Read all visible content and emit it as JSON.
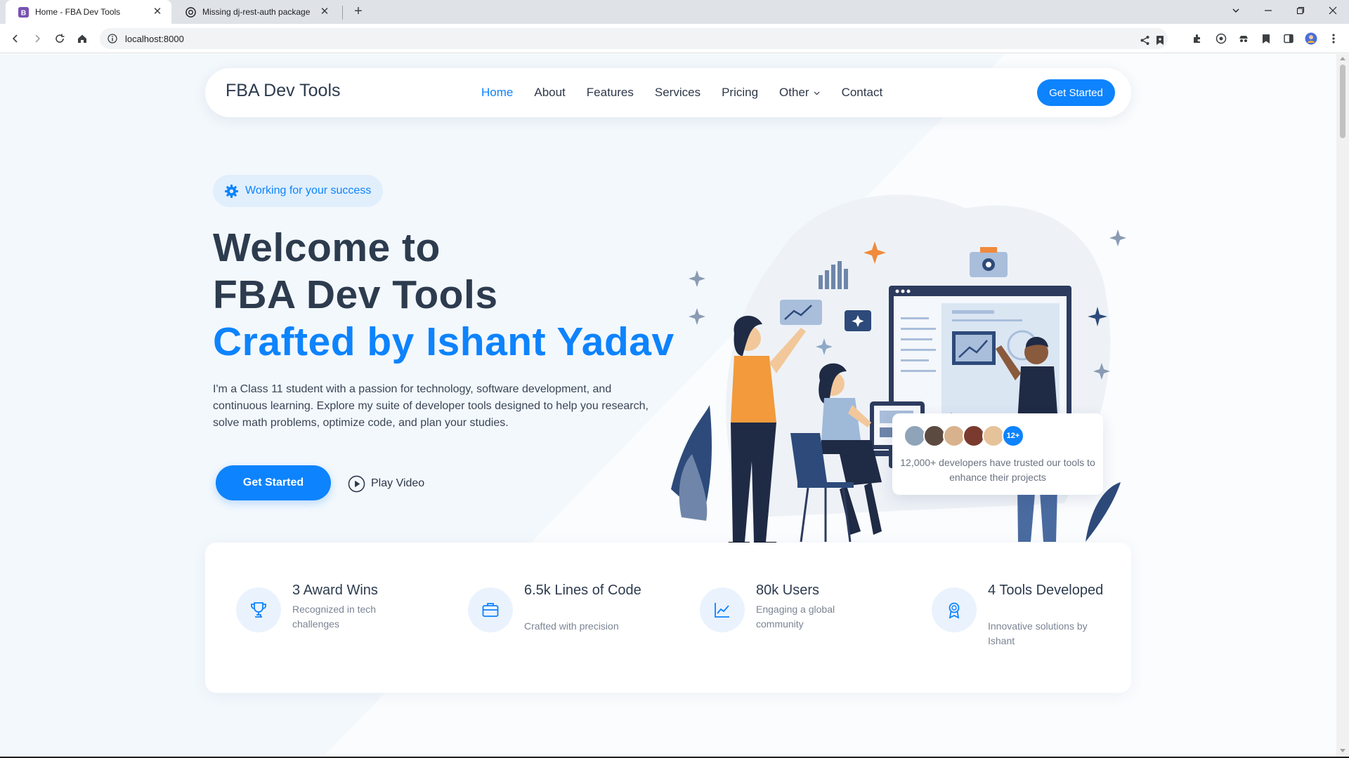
{
  "browser": {
    "tabs": [
      {
        "title": "Home - FBA Dev Tools",
        "favicon": "bootstrap-icon",
        "active": true
      },
      {
        "title": "Missing dj-rest-auth package",
        "favicon": "chatgpt-icon",
        "active": false
      }
    ],
    "url": "localhost:8000"
  },
  "header": {
    "logo": "FBA Dev Tools",
    "nav": [
      {
        "label": "Home",
        "active": true
      },
      {
        "label": "About"
      },
      {
        "label": "Features"
      },
      {
        "label": "Services"
      },
      {
        "label": "Pricing"
      },
      {
        "label": "Other",
        "dropdown": true
      },
      {
        "label": "Contact"
      }
    ],
    "cta": "Get Started"
  },
  "hero": {
    "badge": "Working for your success",
    "heading_line1": "Welcome to",
    "heading_line2": "FBA Dev Tools",
    "heading_line3": "Crafted by Ishant Yadav",
    "description": "I'm a Class 11 student with a passion for technology, software development, and continuous learning. Explore my suite of developer tools designed to help you research, solve math problems, optimize code, and plan your studies.",
    "primary_button": "Get Started",
    "video_button": "Play Video"
  },
  "trust_card": {
    "more_label": "12+",
    "text": "12,000+ developers have trusted our tools to enhance their projects"
  },
  "stats": [
    {
      "icon": "trophy-icon",
      "title": "3 Award Wins",
      "desc": "Recognized in tech challenges"
    },
    {
      "icon": "briefcase-icon",
      "title": "6.5k Lines of Code",
      "desc": "Crafted with precision"
    },
    {
      "icon": "graph-up-icon",
      "title": "80k Users",
      "desc": "Engaging a global community"
    },
    {
      "icon": "award-icon",
      "title": "4 Tools Developed",
      "desc": "Innovative solutions by Ishant"
    }
  ],
  "colors": {
    "accent": "#0d83fd",
    "heading": "#2d3b4e",
    "page_bg": "#f3f8fd"
  }
}
